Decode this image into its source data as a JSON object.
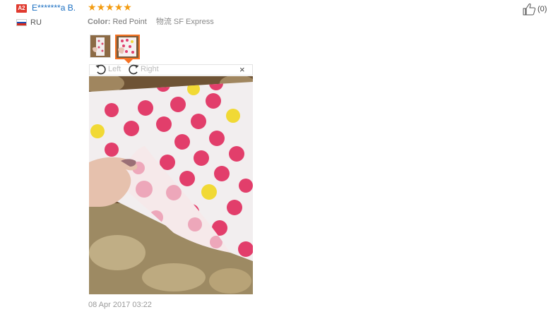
{
  "reviewer": {
    "badge": "A2",
    "name": "E*******a B.",
    "country": "RU"
  },
  "rating": {
    "stars": 5,
    "max": 5
  },
  "order_info": {
    "color_label": "Color:",
    "color_value": "Red Point",
    "shipping": "物流 SF Express"
  },
  "helpful": {
    "count_text": "(0)"
  },
  "viewer": {
    "rotate_left_label": "Left",
    "rotate_right_label": "Right",
    "close_glyph": "×"
  },
  "date": "08 Apr 2017 03:22",
  "colors": {
    "accent": "#f57224",
    "link": "#1b6fc2",
    "star": "#f39c12",
    "badge": "#e03a2f"
  }
}
